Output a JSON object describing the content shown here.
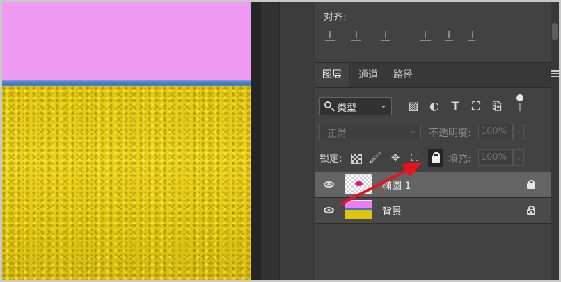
{
  "canvas": {
    "watermark": ""
  },
  "align_panel": {
    "title": "对齐:",
    "icons": [
      "align-left-icon",
      "align-horizontal-center-icon",
      "align-right-icon",
      "align-top-icon",
      "align-vertical-center-icon",
      "align-bottom-icon"
    ]
  },
  "layers_panel": {
    "tabs": [
      {
        "label": "图层",
        "active": true
      },
      {
        "label": "通道",
        "active": false
      },
      {
        "label": "路径",
        "active": false
      }
    ],
    "filter": {
      "kind_label": "类型",
      "icons": [
        "image-filter-icon",
        "adjustment-filter-icon",
        "type-filter-icon",
        "shape-filter-icon",
        "smart-object-filter-icon"
      ]
    },
    "blend_mode": "正常",
    "opacity_label": "不透明度:",
    "opacity_value": "100%",
    "lock_label": "锁定:",
    "lock_icons": [
      "lock-transparent-pixels-icon",
      "lock-image-pixels-icon",
      "lock-position-icon",
      "lock-artboard-icon",
      "lock-all-icon"
    ],
    "fill_label": "填充:",
    "fill_value": "100%",
    "layers": [
      {
        "name": "椭圆 1",
        "visible": true,
        "locked": "all",
        "selected": true
      },
      {
        "name": "背景",
        "visible": true,
        "locked": "background",
        "selected": false
      }
    ]
  },
  "annotation": {
    "arrow_color": "#e8141c"
  },
  "colors": {
    "panel_bg": "#424242",
    "selected_row": "#646464",
    "sky": "#ef9af3",
    "field": "#e6c80e"
  }
}
